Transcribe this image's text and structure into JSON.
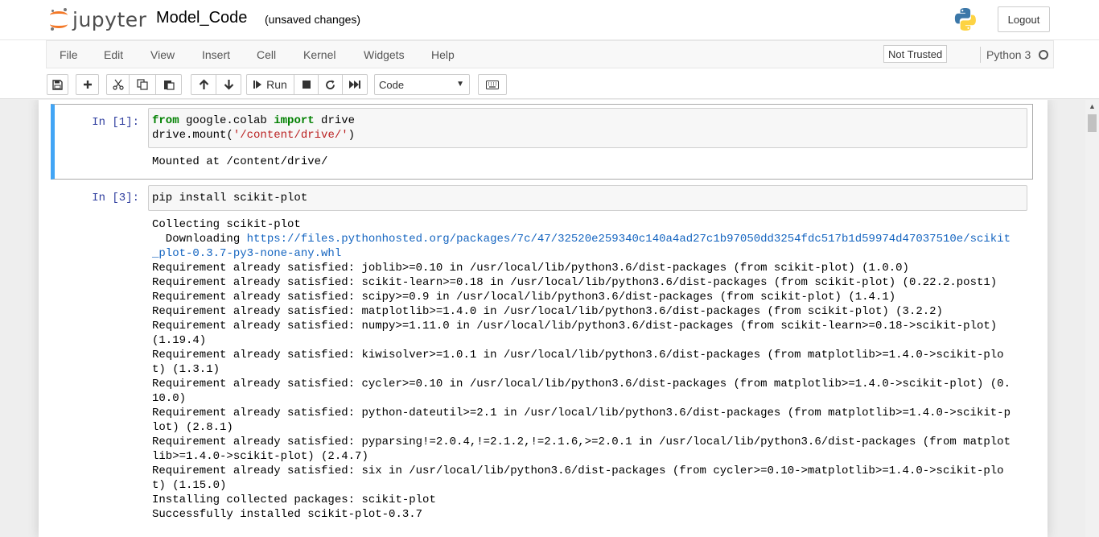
{
  "header": {
    "logo_text": "jupyter",
    "notebook_name": "Model_Code",
    "save_status": "(unsaved changes)",
    "logout_label": "Logout"
  },
  "menubar": {
    "items": [
      "File",
      "Edit",
      "View",
      "Insert",
      "Cell",
      "Kernel",
      "Widgets",
      "Help"
    ],
    "trust_label": "Not Trusted",
    "kernel_name": "Python 3"
  },
  "toolbar": {
    "run_label": "Run",
    "cell_type": "Code",
    "icons": [
      "save-icon",
      "plus-icon",
      "cut-icon",
      "copy-icon",
      "paste-icon",
      "arrow-up-icon",
      "arrow-down-icon",
      "step-forward-icon",
      "stop-icon",
      "restart-icon",
      "fast-forward-icon",
      "keyboard-icon"
    ]
  },
  "cells": [
    {
      "prompt": "In [1]:",
      "code_lines": [
        [
          {
            "t": "from",
            "c": "kw"
          },
          {
            "t": " google.colab "
          },
          {
            "t": "import",
            "c": "kw"
          },
          {
            "t": " drive"
          }
        ],
        [
          {
            "t": "drive.mount("
          },
          {
            "t": "'/content/drive/'",
            "c": "str"
          },
          {
            "t": ")"
          }
        ]
      ],
      "output_lines": [
        [
          {
            "t": "Mounted at /content/drive/"
          }
        ]
      ]
    },
    {
      "prompt": "In [3]:",
      "code_lines": [
        [
          {
            "t": "pip install scikit-plot"
          }
        ]
      ],
      "output_lines": [
        [
          {
            "t": "Collecting scikit-plot"
          }
        ],
        [
          {
            "t": "  Downloading "
          },
          {
            "t": "https://files.pythonhosted.org/packages/7c/47/32520e259340c140a4ad27c1b97050dd3254fdc517b1d59974d47037510e/scikit",
            "c": "url"
          }
        ],
        [
          {
            "t": "_plot-0.3.7-py3-none-any.whl",
            "c": "url"
          }
        ],
        [
          {
            "t": "Requirement already satisfied: joblib>=0.10 in /usr/local/lib/python3.6/dist-packages (from scikit-plot) (1.0.0)"
          }
        ],
        [
          {
            "t": "Requirement already satisfied: scikit-learn>=0.18 in /usr/local/lib/python3.6/dist-packages (from scikit-plot) (0.22.2.post1)"
          }
        ],
        [
          {
            "t": "Requirement already satisfied: scipy>=0.9 in /usr/local/lib/python3.6/dist-packages (from scikit-plot) (1.4.1)"
          }
        ],
        [
          {
            "t": "Requirement already satisfied: matplotlib>=1.4.0 in /usr/local/lib/python3.6/dist-packages (from scikit-plot) (3.2.2)"
          }
        ],
        [
          {
            "t": "Requirement already satisfied: numpy>=1.11.0 in /usr/local/lib/python3.6/dist-packages (from scikit-learn>=0.18->scikit-plot)"
          }
        ],
        [
          {
            "t": "(1.19.4)"
          }
        ],
        [
          {
            "t": "Requirement already satisfied: kiwisolver>=1.0.1 in /usr/local/lib/python3.6/dist-packages (from matplotlib>=1.4.0->scikit-plo"
          }
        ],
        [
          {
            "t": "t) (1.3.1)"
          }
        ],
        [
          {
            "t": "Requirement already satisfied: cycler>=0.10 in /usr/local/lib/python3.6/dist-packages (from matplotlib>=1.4.0->scikit-plot) (0."
          }
        ],
        [
          {
            "t": "10.0)"
          }
        ],
        [
          {
            "t": "Requirement already satisfied: python-dateutil>=2.1 in /usr/local/lib/python3.6/dist-packages (from matplotlib>=1.4.0->scikit-p"
          }
        ],
        [
          {
            "t": "lot) (2.8.1)"
          }
        ],
        [
          {
            "t": "Requirement already satisfied: pyparsing!=2.0.4,!=2.1.2,!=2.1.6,>=2.0.1 in /usr/local/lib/python3.6/dist-packages (from matplot"
          }
        ],
        [
          {
            "t": "lib>=1.4.0->scikit-plot) (2.4.7)"
          }
        ],
        [
          {
            "t": "Requirement already satisfied: six in /usr/local/lib/python3.6/dist-packages (from cycler>=0.10->matplotlib>=1.4.0->scikit-plo"
          }
        ],
        [
          {
            "t": "t) (1.15.0)"
          }
        ],
        [
          {
            "t": "Installing collected packages: scikit-plot"
          }
        ],
        [
          {
            "t": "Successfully installed scikit-plot-0.3.7"
          }
        ]
      ]
    }
  ]
}
